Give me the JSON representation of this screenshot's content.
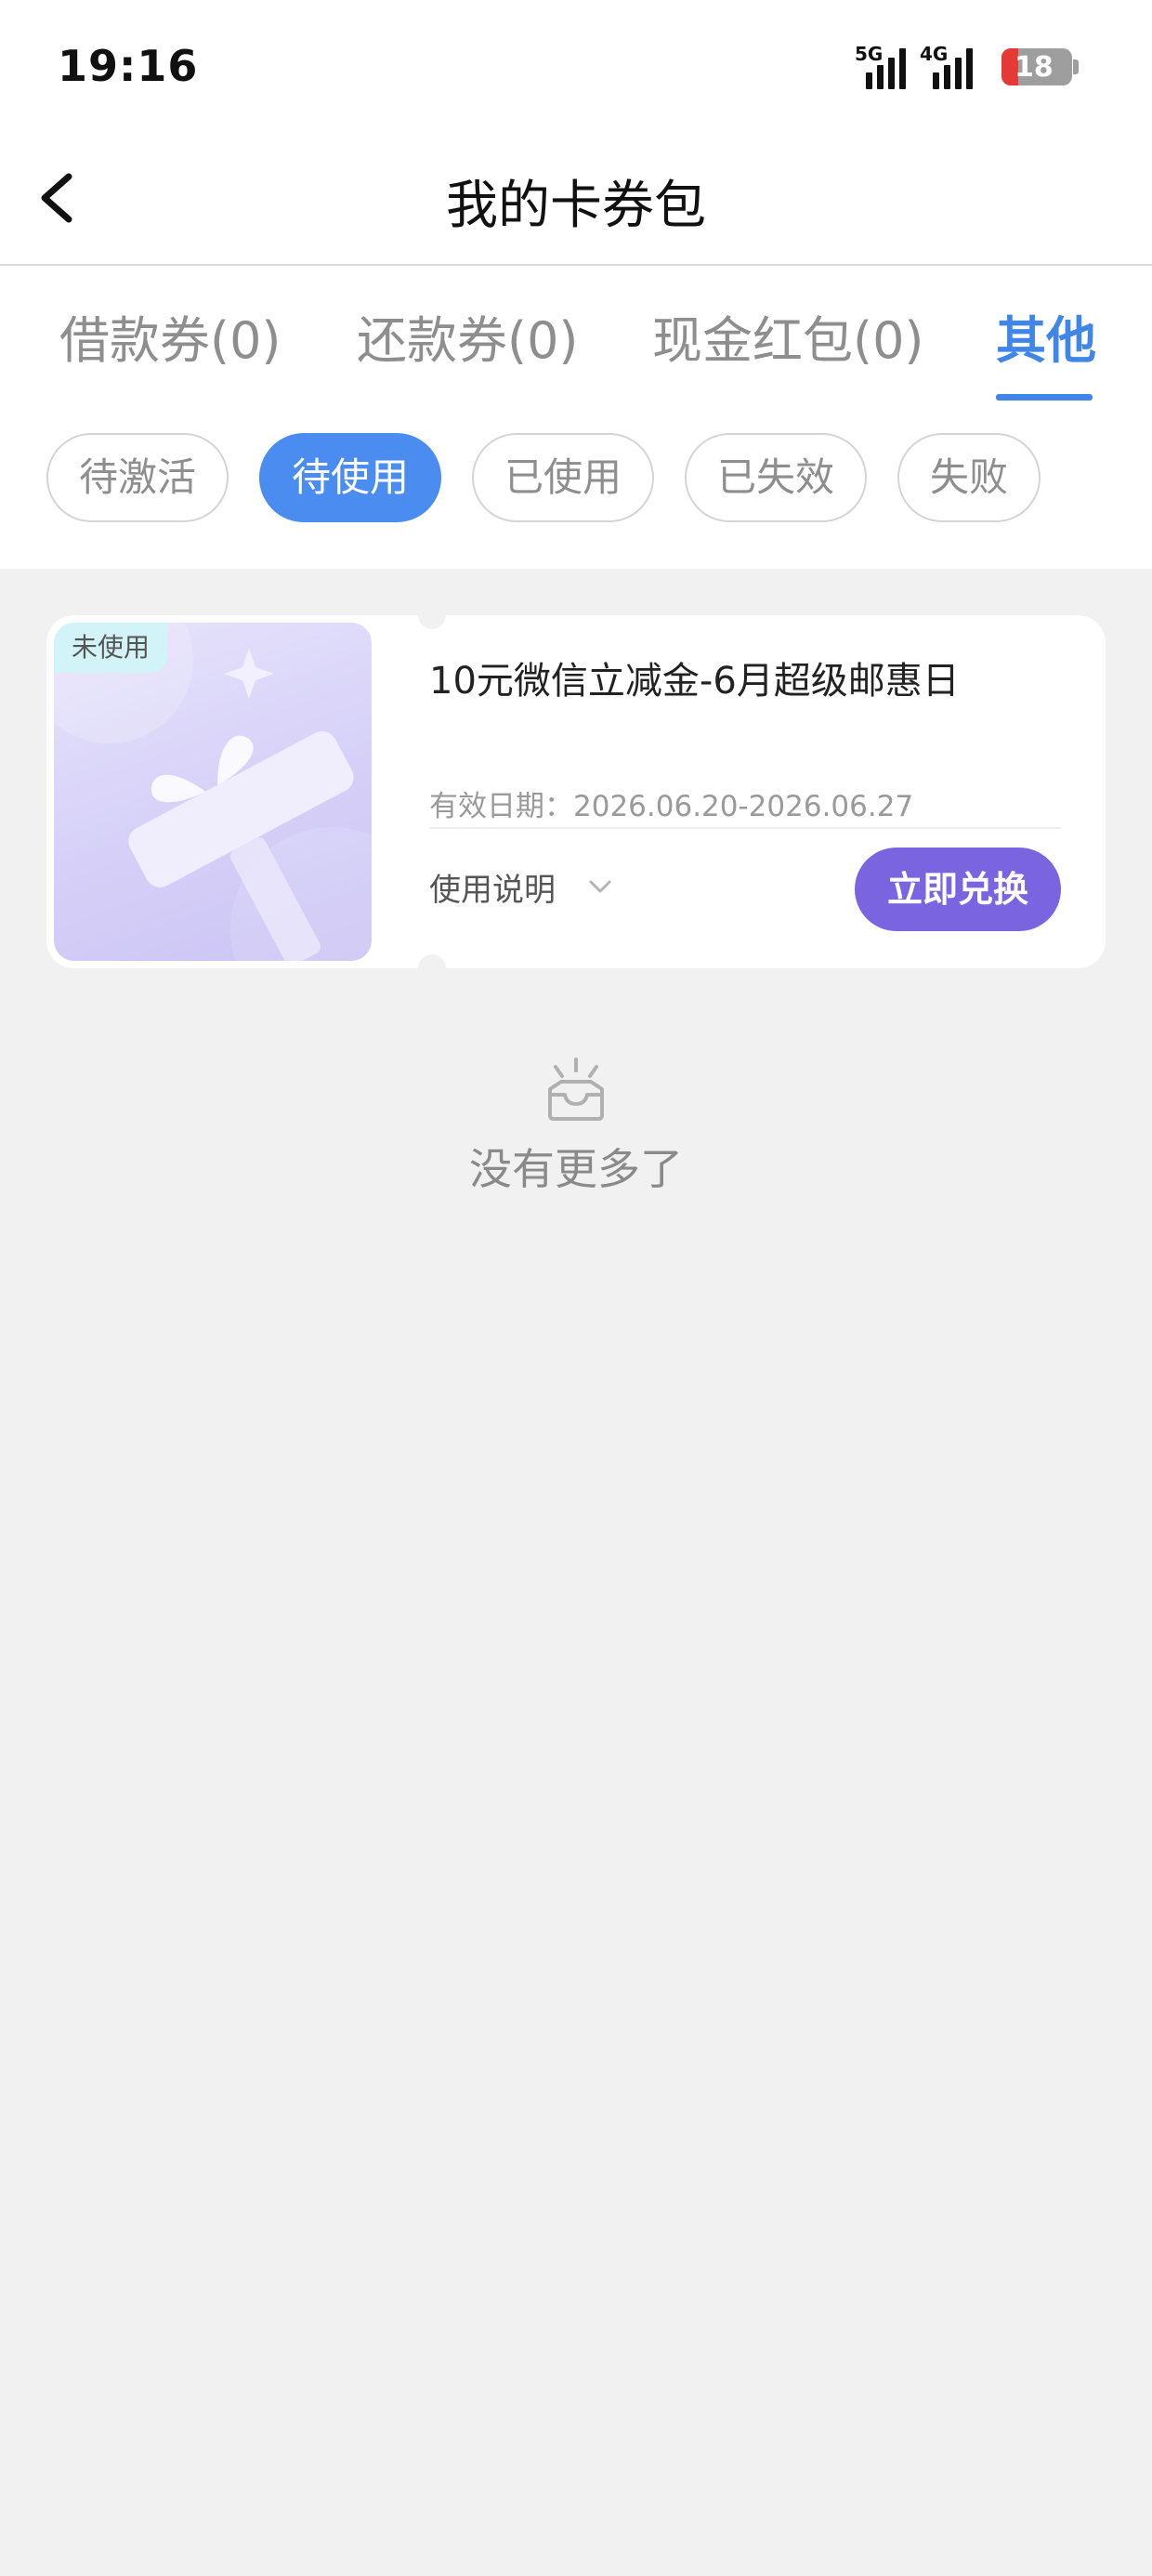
{
  "status_bar": {
    "time": "19:16",
    "sim1_label": "5G",
    "sim2_label": "4G",
    "battery": "18"
  },
  "header": {
    "title": "我的卡券包",
    "back_icon": "chevron-left-icon"
  },
  "tabs": [
    {
      "label": "借款券(0)",
      "active": false
    },
    {
      "label": "还款券(0)",
      "active": false
    },
    {
      "label": "现金红包(0)",
      "active": false
    },
    {
      "label": "其他",
      "active": true
    }
  ],
  "filters": [
    {
      "label": "待激活",
      "active": false
    },
    {
      "label": "待使用",
      "active": true
    },
    {
      "label": "已使用",
      "active": false
    },
    {
      "label": "已失效",
      "active": false
    },
    {
      "label": "失败",
      "active": false
    }
  ],
  "coupon": {
    "badge": "未使用",
    "title": "10元微信立减金-6月超级邮惠日",
    "validity": "有效日期：2026.06.20-2026.06.27",
    "usage_note": "使用说明",
    "redeem_label": "立即兑换"
  },
  "empty_state": {
    "text": "没有更多了",
    "icon": "empty-inbox-icon"
  },
  "colors": {
    "accent_blue": "#3f86e8",
    "chip_active": "#4a8cf0",
    "redeem_purple": "#7a64e0",
    "badge_cyan": "#d2f4f8",
    "battery_low": "#e53935"
  }
}
